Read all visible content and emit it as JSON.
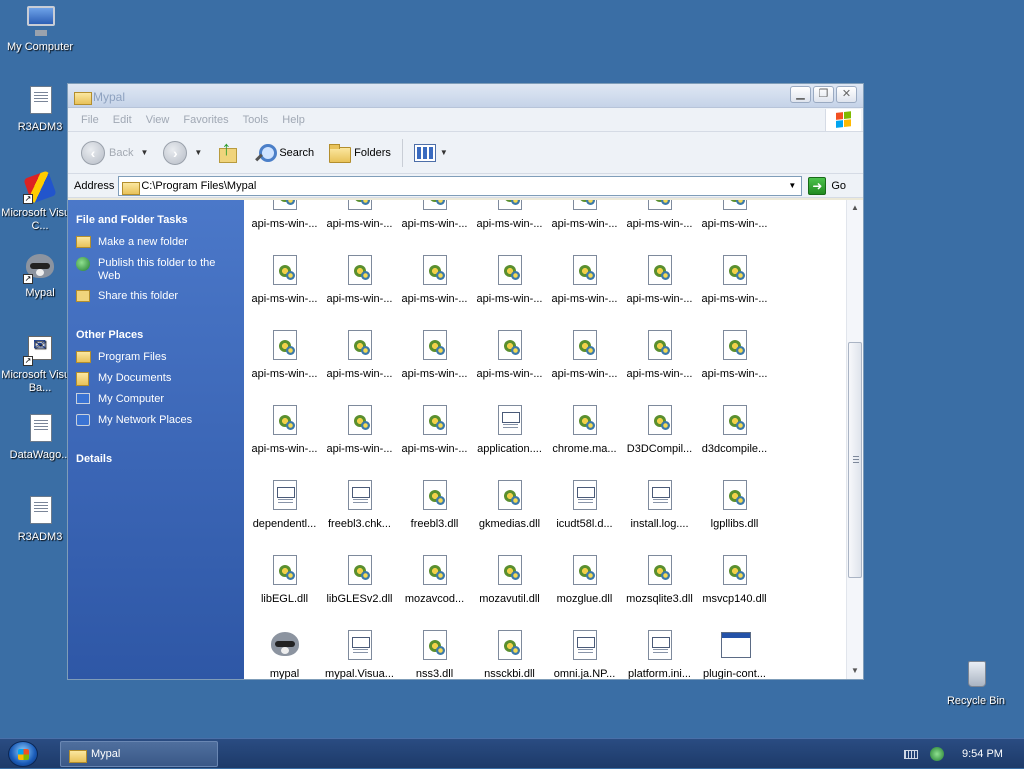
{
  "desktop": {
    "icons": [
      {
        "label": "My Computer"
      },
      {
        "label": "R3ADM3"
      },
      {
        "label": "Microsoft Visual C..."
      },
      {
        "label": "Mypal"
      },
      {
        "label": "Microsoft Visual Ba..."
      },
      {
        "label": "DataWago..."
      },
      {
        "label": "R3ADM3"
      },
      {
        "label": "Recycle Bin"
      }
    ]
  },
  "window": {
    "title": "Mypal",
    "menu": [
      "File",
      "Edit",
      "View",
      "Favorites",
      "Tools",
      "Help"
    ],
    "toolbar": {
      "back_label": "Back",
      "search_label": "Search",
      "folders_label": "Folders"
    },
    "address": {
      "label": "Address",
      "value": "C:\\Program Files\\Mypal",
      "go_label": "Go"
    },
    "taskpane": {
      "file_tasks_title": "File and Folder Tasks",
      "file_tasks": [
        "Make a new folder",
        "Publish this folder to the Web",
        "Share this folder"
      ],
      "other_places_title": "Other Places",
      "other_places": [
        "Program Files",
        "My Documents",
        "My Computer",
        "My Network Places"
      ],
      "details_title": "Details"
    },
    "files": [
      {
        "name": "api-ms-win-...",
        "type": "dll"
      },
      {
        "name": "api-ms-win-...",
        "type": "dll"
      },
      {
        "name": "api-ms-win-...",
        "type": "dll"
      },
      {
        "name": "api-ms-win-...",
        "type": "dll"
      },
      {
        "name": "api-ms-win-...",
        "type": "dll"
      },
      {
        "name": "api-ms-win-...",
        "type": "dll"
      },
      {
        "name": "api-ms-win-...",
        "type": "dll"
      },
      {
        "name": "api-ms-win-...",
        "type": "dll"
      },
      {
        "name": "api-ms-win-...",
        "type": "dll"
      },
      {
        "name": "api-ms-win-...",
        "type": "dll"
      },
      {
        "name": "api-ms-win-...",
        "type": "dll"
      },
      {
        "name": "api-ms-win-...",
        "type": "dll"
      },
      {
        "name": "api-ms-win-...",
        "type": "dll"
      },
      {
        "name": "api-ms-win-...",
        "type": "dll"
      },
      {
        "name": "api-ms-win-...",
        "type": "dll"
      },
      {
        "name": "api-ms-win-...",
        "type": "dll"
      },
      {
        "name": "api-ms-win-...",
        "type": "dll"
      },
      {
        "name": "api-ms-win-...",
        "type": "dll"
      },
      {
        "name": "api-ms-win-...",
        "type": "dll"
      },
      {
        "name": "api-ms-win-...",
        "type": "dll"
      },
      {
        "name": "api-ms-win-...",
        "type": "dll"
      },
      {
        "name": "api-ms-win-...",
        "type": "dll"
      },
      {
        "name": "api-ms-win-...",
        "type": "dll"
      },
      {
        "name": "api-ms-win-...",
        "type": "dll"
      },
      {
        "name": "application....",
        "type": "txt"
      },
      {
        "name": "chrome.ma...",
        "type": "dll"
      },
      {
        "name": "D3DCompil...",
        "type": "dll"
      },
      {
        "name": "d3dcompile...",
        "type": "dll"
      },
      {
        "name": "dependentl...",
        "type": "txt"
      },
      {
        "name": "freebl3.chk...",
        "type": "txt"
      },
      {
        "name": "freebl3.dll",
        "type": "dll"
      },
      {
        "name": "gkmedias.dll",
        "type": "dll"
      },
      {
        "name": "icudt58l.d...",
        "type": "txt"
      },
      {
        "name": "install.log....",
        "type": "txt"
      },
      {
        "name": "lgpllibs.dll",
        "type": "dll"
      },
      {
        "name": "libEGL.dll",
        "type": "dll"
      },
      {
        "name": "libGLESv2.dll",
        "type": "dll"
      },
      {
        "name": "mozavcod...",
        "type": "dll"
      },
      {
        "name": "mozavutil.dll",
        "type": "dll"
      },
      {
        "name": "mozglue.dll",
        "type": "dll"
      },
      {
        "name": "mozsqlite3.dll",
        "type": "dll"
      },
      {
        "name": "msvcp140.dll",
        "type": "dll"
      },
      {
        "name": "mypal",
        "type": "exe"
      },
      {
        "name": "mypal.Visua...",
        "type": "txt"
      },
      {
        "name": "nss3.dll",
        "type": "dll"
      },
      {
        "name": "nssckbi.dll",
        "type": "dll"
      },
      {
        "name": "omni.ja.NP...",
        "type": "txt"
      },
      {
        "name": "platform.ini...",
        "type": "txt"
      },
      {
        "name": "plugin-cont...",
        "type": "app"
      }
    ]
  },
  "taskbar": {
    "task_label": "Mypal",
    "clock": "9:54 PM"
  }
}
